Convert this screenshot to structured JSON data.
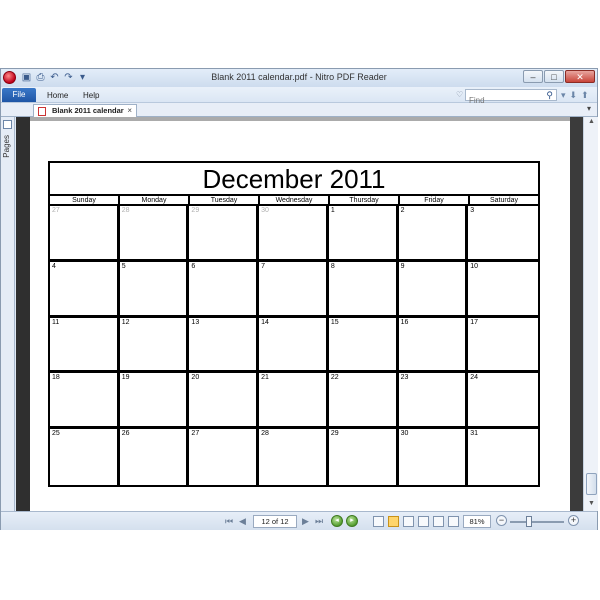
{
  "window": {
    "title": "Blank 2011 calendar.pdf - Nitro PDF Reader",
    "controls": [
      "–",
      "□",
      "✕"
    ]
  },
  "ribbon": {
    "file_label": "File",
    "tabs": [
      "Home",
      "Help"
    ],
    "find_placeholder": "Find"
  },
  "document_tab": {
    "label": "Blank 2011 calendar",
    "close": "×"
  },
  "side_panel": {
    "pages_label": "Pages"
  },
  "status_bar": {
    "page_indicator": "12 of 12",
    "zoom": "81%"
  },
  "calendar": {
    "title": "December 2011",
    "weekdays": [
      "Sunday",
      "Monday",
      "Tuesday",
      "Wednesday",
      "Thursday",
      "Friday",
      "Saturday"
    ],
    "days": [
      {
        "n": "27",
        "muted": true
      },
      {
        "n": "28",
        "muted": true
      },
      {
        "n": "29",
        "muted": true
      },
      {
        "n": "30",
        "muted": true
      },
      {
        "n": "1",
        "muted": false
      },
      {
        "n": "2",
        "muted": false
      },
      {
        "n": "3",
        "muted": false
      },
      {
        "n": "4",
        "muted": false
      },
      {
        "n": "5",
        "muted": false
      },
      {
        "n": "6",
        "muted": false
      },
      {
        "n": "7",
        "muted": false
      },
      {
        "n": "8",
        "muted": false
      },
      {
        "n": "9",
        "muted": false
      },
      {
        "n": "10",
        "muted": false
      },
      {
        "n": "11",
        "muted": false
      },
      {
        "n": "12",
        "muted": false
      },
      {
        "n": "13",
        "muted": false
      },
      {
        "n": "14",
        "muted": false
      },
      {
        "n": "15",
        "muted": false
      },
      {
        "n": "16",
        "muted": false
      },
      {
        "n": "17",
        "muted": false
      },
      {
        "n": "18",
        "muted": false
      },
      {
        "n": "19",
        "muted": false
      },
      {
        "n": "20",
        "muted": false
      },
      {
        "n": "21",
        "muted": false
      },
      {
        "n": "22",
        "muted": false
      },
      {
        "n": "23",
        "muted": false
      },
      {
        "n": "24",
        "muted": false
      },
      {
        "n": "25",
        "muted": false
      },
      {
        "n": "26",
        "muted": false
      },
      {
        "n": "27",
        "muted": false
      },
      {
        "n": "28",
        "muted": false
      },
      {
        "n": "29",
        "muted": false
      },
      {
        "n": "30",
        "muted": false
      },
      {
        "n": "31",
        "muted": false
      }
    ]
  },
  "colors": {
    "file_tab": "#1f56a6",
    "active_view_button": "#ffd56b",
    "page_shadow": "#2f2f2f"
  },
  "icons": [
    "app-orb-icon",
    "save-icon",
    "print-icon",
    "undo-icon",
    "redo-icon",
    "search-icon",
    "heart-icon",
    "pdf-icon",
    "first-page-icon",
    "prev-page-icon",
    "next-page-icon",
    "last-page-icon",
    "go-back-icon",
    "go-forward-icon"
  ]
}
